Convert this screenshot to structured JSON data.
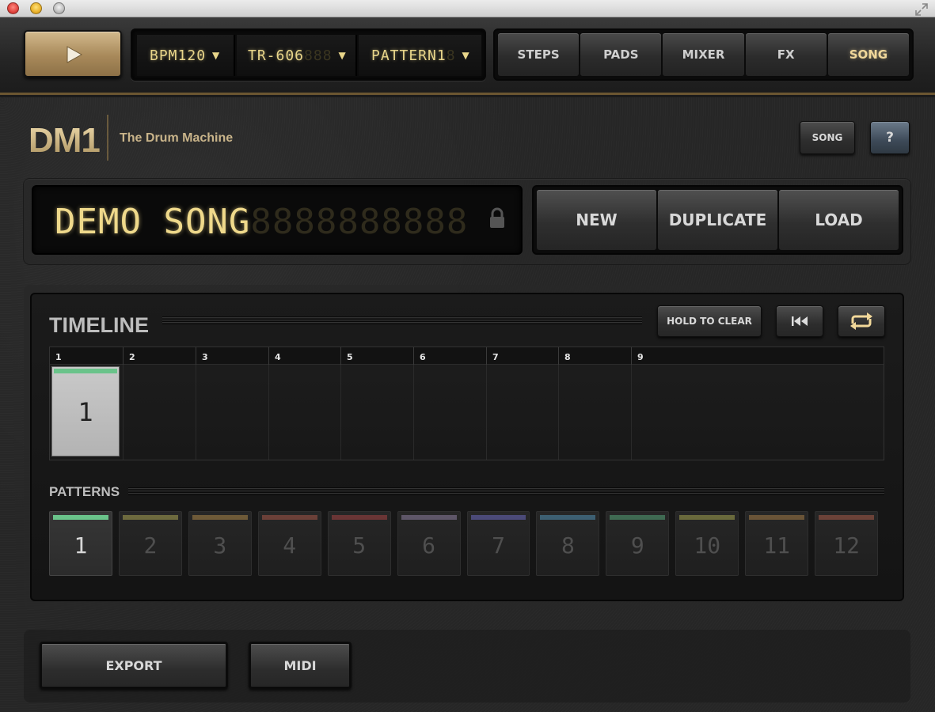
{
  "toolbar": {
    "bpm_label": "BPM",
    "bpm_value": "120",
    "kit": "TR-606",
    "kit_ghost": "888",
    "pattern_label": "PATTERN",
    "pattern_value": "1",
    "pattern_ghost": "8",
    "tabs": [
      {
        "label": "STEPS",
        "active": false
      },
      {
        "label": "PADS",
        "active": false
      },
      {
        "label": "MIXER",
        "active": false
      },
      {
        "label": "FX",
        "active": false
      },
      {
        "label": "SONG",
        "active": true
      }
    ]
  },
  "header": {
    "logo": "DM1",
    "subtitle": "The Drum Machine",
    "song_button": "SONG",
    "help_button": "?"
  },
  "song": {
    "name": "DEMO SONG",
    "ghost": "8888888888",
    "actions": [
      "NEW",
      "DUPLICATE",
      "LOAD"
    ]
  },
  "timeline": {
    "title": "TIMELINE",
    "hold_to_clear": "HOLD TO CLEAR",
    "bars": [
      "1",
      "2",
      "3",
      "4",
      "5",
      "6",
      "7",
      "8",
      "9"
    ],
    "first_slot_pattern": "1"
  },
  "patterns": {
    "title": "PATTERNS",
    "items": [
      {
        "label": "1",
        "color": "#6ac38a",
        "active": true
      },
      {
        "label": "2",
        "color": "#6d6a3e",
        "active": false
      },
      {
        "label": "3",
        "color": "#6e5a38",
        "active": false
      },
      {
        "label": "4",
        "color": "#6b4038",
        "active": false
      },
      {
        "label": "5",
        "color": "#6a3535",
        "active": false
      },
      {
        "label": "6",
        "color": "#5e5668",
        "active": false
      },
      {
        "label": "7",
        "color": "#4b4a78",
        "active": false
      },
      {
        "label": "8",
        "color": "#3d5f72",
        "active": false
      },
      {
        "label": "9",
        "color": "#3f6a52",
        "active": false
      },
      {
        "label": "10",
        "color": "#6a6a3c",
        "active": false
      },
      {
        "label": "11",
        "color": "#6a5437",
        "active": false
      },
      {
        "label": "12",
        "color": "#6b4238",
        "active": false
      }
    ]
  },
  "bottom": {
    "export": "EXPORT",
    "midi": "MIDI"
  }
}
